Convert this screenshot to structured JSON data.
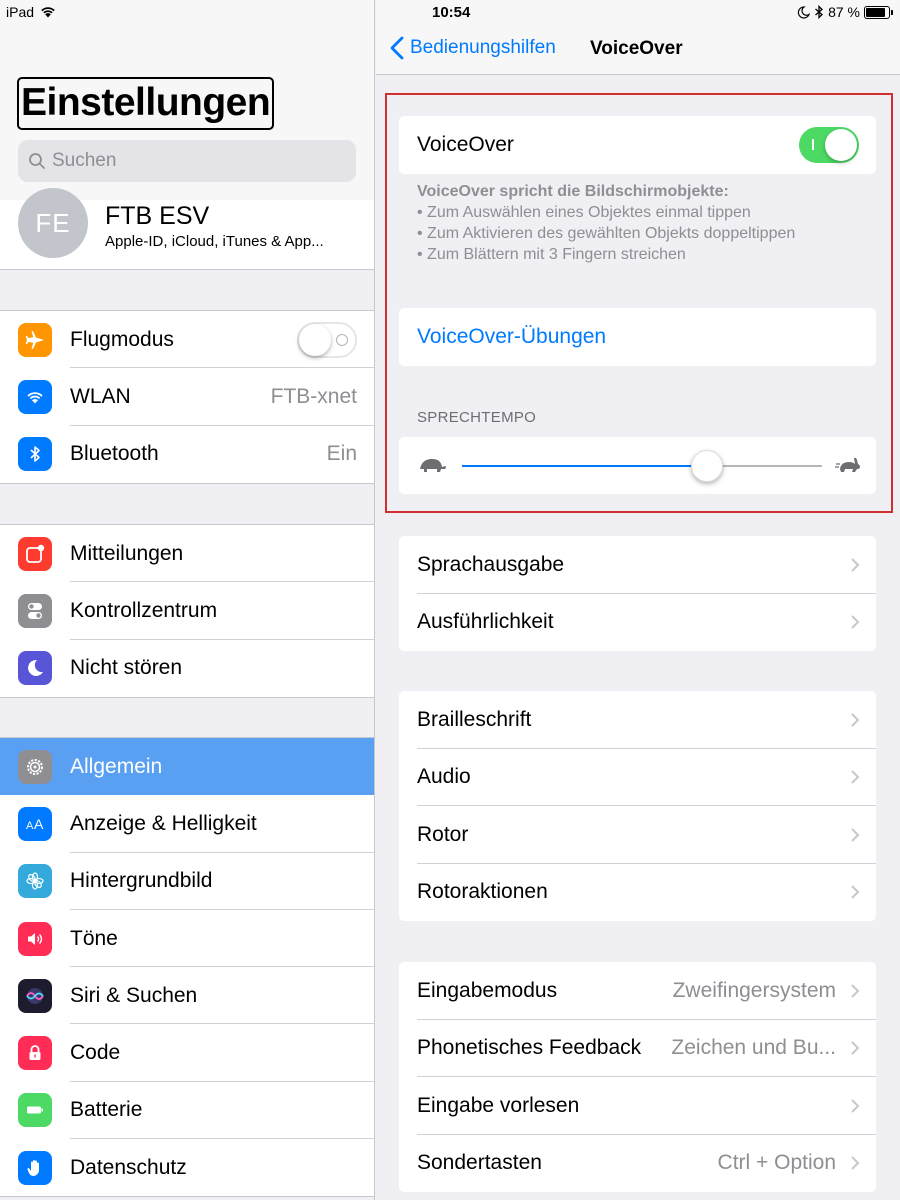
{
  "statusbar": {
    "device": "iPad",
    "time": "10:54",
    "battery_text": "87 %",
    "battery_level": 0.87
  },
  "left": {
    "title": "Einstellungen",
    "search_placeholder": "Suchen",
    "profile": {
      "initials": "FE",
      "name": "FTB ESV",
      "subtitle": "Apple-ID, iCloud, iTunes & App..."
    },
    "groups": [
      {
        "items": [
          {
            "label": "Flugmodus",
            "icon": "airplane-icon",
            "color": "#ff9500",
            "toggle": "off"
          },
          {
            "label": "WLAN",
            "icon": "wifi-icon",
            "color": "#007aff",
            "value": "FTB-xnet"
          },
          {
            "label": "Bluetooth",
            "icon": "bluetooth-icon",
            "color": "#007aff",
            "value": "Ein"
          }
        ]
      },
      {
        "items": [
          {
            "label": "Mitteilungen",
            "icon": "notifications-icon",
            "color": "#ff3b30"
          },
          {
            "label": "Kontrollzentrum",
            "icon": "control-center-icon",
            "color": "#8e8e93"
          },
          {
            "label": "Nicht stören",
            "icon": "moon-icon",
            "color": "#5856d6"
          }
        ]
      },
      {
        "items": [
          {
            "label": "Allgemein",
            "icon": "gear-icon",
            "color": "#8e8e93",
            "selected": true
          },
          {
            "label": "Anzeige & Helligkeit",
            "icon": "text-size-icon",
            "color": "#007aff"
          },
          {
            "label": "Hintergrundbild",
            "icon": "wallpaper-icon",
            "color": "#34aadc"
          },
          {
            "label": "Töne",
            "icon": "speaker-icon",
            "color": "#ff2d55"
          },
          {
            "label": "Siri & Suchen",
            "icon": "siri-icon",
            "color": "#1c1c2e"
          },
          {
            "label": "Code",
            "icon": "lock-icon",
            "color": "#ff2d55"
          },
          {
            "label": "Batterie",
            "icon": "battery-icon",
            "color": "#4cd964"
          },
          {
            "label": "Datenschutz",
            "icon": "hand-icon",
            "color": "#007aff"
          }
        ]
      }
    ]
  },
  "right": {
    "back_label": "Bedienungshilfen",
    "title": "VoiceOver",
    "voiceover_label": "VoiceOver",
    "voiceover_on": true,
    "info_heading": "VoiceOver spricht die Bildschirmobjekte:",
    "info_lines": [
      "• Zum Auswählen eines Objektes einmal tippen",
      "• Zum Aktivieren des gewählten Objekts doppeltippen",
      "• Zum Blättern mit 3 Fingern streichen"
    ],
    "practice_label": "VoiceOver-Übungen",
    "speech_rate_label": "SPRECHTEMPO",
    "speech_rate": 0.68,
    "groups": [
      {
        "items": [
          {
            "label": "Sprachausgabe"
          },
          {
            "label": "Ausführlichkeit"
          }
        ]
      },
      {
        "items": [
          {
            "label": "Brailleschrift"
          },
          {
            "label": "Audio"
          },
          {
            "label": "Rotor"
          },
          {
            "label": "Rotoraktionen"
          }
        ]
      },
      {
        "items": [
          {
            "label": "Eingabemodus",
            "value": "Zweifingersystem"
          },
          {
            "label": "Phonetisches Feedback",
            "value": "Zeichen und Bu..."
          },
          {
            "label": "Eingabe vorlesen"
          },
          {
            "label": "Sondertasten",
            "value": "Ctrl + Option"
          }
        ]
      }
    ]
  }
}
